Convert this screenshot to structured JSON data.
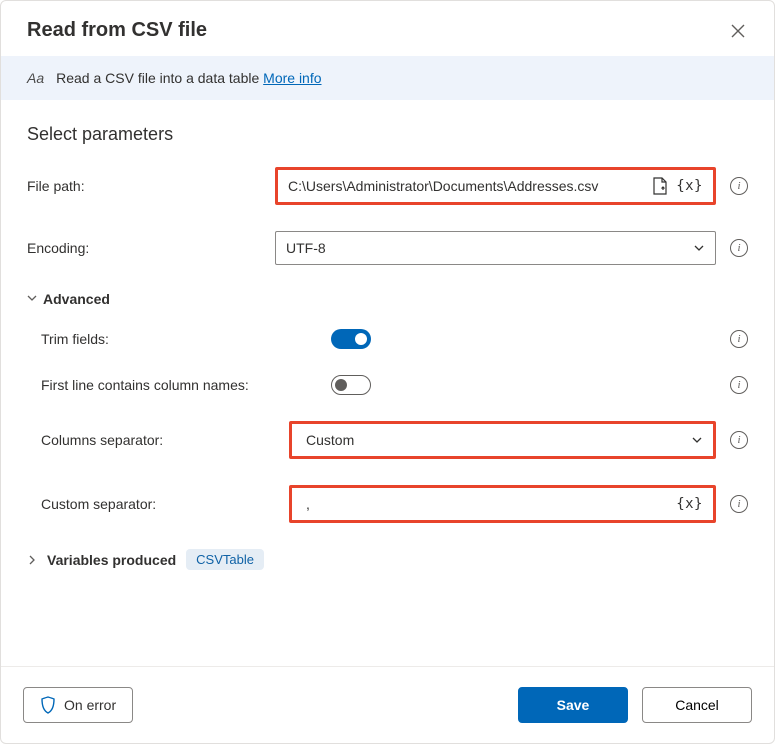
{
  "dialog": {
    "title": "Read from CSV file",
    "banner_text": "Read a CSV file into a data table ",
    "more_info_label": "More info",
    "section_heading": "Select parameters",
    "file_path_label": "File path:",
    "file_path_value": "C:\\Users\\Administrator\\Documents\\Addresses.csv",
    "var_token": "{x}",
    "encoding_label": "Encoding:",
    "encoding_value": "UTF-8",
    "advanced_label": "Advanced",
    "trim_label": "Trim fields:",
    "first_line_label": "First line contains column names:",
    "columns_sep_label": "Columns separator:",
    "columns_sep_value": "Custom",
    "custom_sep_label": "Custom separator:",
    "custom_sep_value": ",",
    "vars_produced_label": "Variables produced",
    "vars_chip": "CSVTable",
    "on_error_label": "On error",
    "save_label": "Save",
    "cancel_label": "Cancel"
  }
}
